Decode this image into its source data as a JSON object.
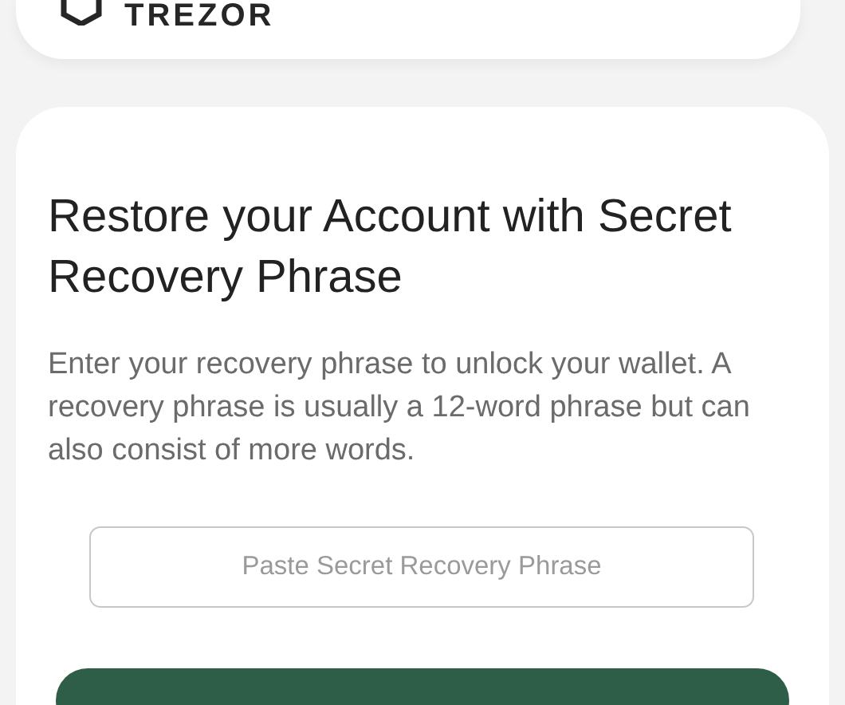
{
  "header": {
    "logo_text": "TREZOR"
  },
  "restore": {
    "title": "Restore your Account with Secret Recovery Phrase",
    "description": "Enter your recovery phrase to unlock your wallet. A recovery phrase is usually a 12-word phrase but can also consist of more words.",
    "phrase_field": {
      "placeholder": "Paste Secret Recovery Phrase"
    }
  }
}
